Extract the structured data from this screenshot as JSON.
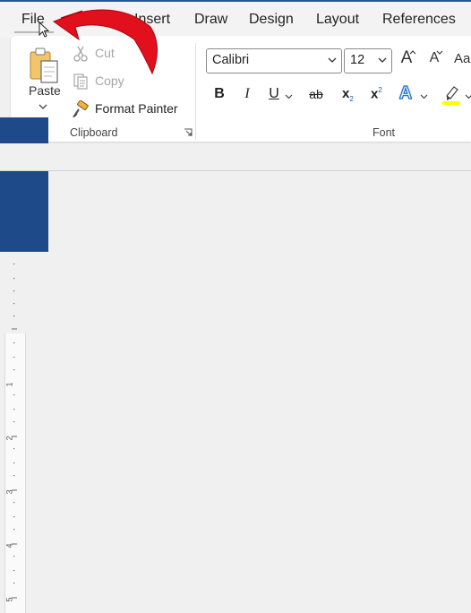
{
  "menu": {
    "tabs": [
      {
        "label": "File"
      },
      {
        "label": "Insert"
      },
      {
        "label": "Draw"
      },
      {
        "label": "Design"
      },
      {
        "label": "Layout"
      },
      {
        "label": "References"
      }
    ]
  },
  "clipboard": {
    "paste_label": "Paste",
    "cut_label": "Cut",
    "copy_label": "Copy",
    "format_painter_label": "Format Painter",
    "group_label": "Clipboard"
  },
  "font": {
    "font_name": "Calibri",
    "font_size": "12",
    "group_label": "Font",
    "bold": "B",
    "italic": "I",
    "underline": "U",
    "strikethrough": "ab",
    "subscript": "x",
    "subscript_mark": "2",
    "superscript": "x",
    "superscript_mark": "2",
    "text_effects": "A",
    "grow_font": "A",
    "shrink_font": "A",
    "change_case": "Aa"
  },
  "ruler": {
    "numbers": [
      "1",
      "2",
      "3",
      "4",
      "5"
    ]
  },
  "colors": {
    "accent_blue": "#2b579a",
    "annotation_red": "#e1101c",
    "highlight_yellow": "#ffff00"
  }
}
